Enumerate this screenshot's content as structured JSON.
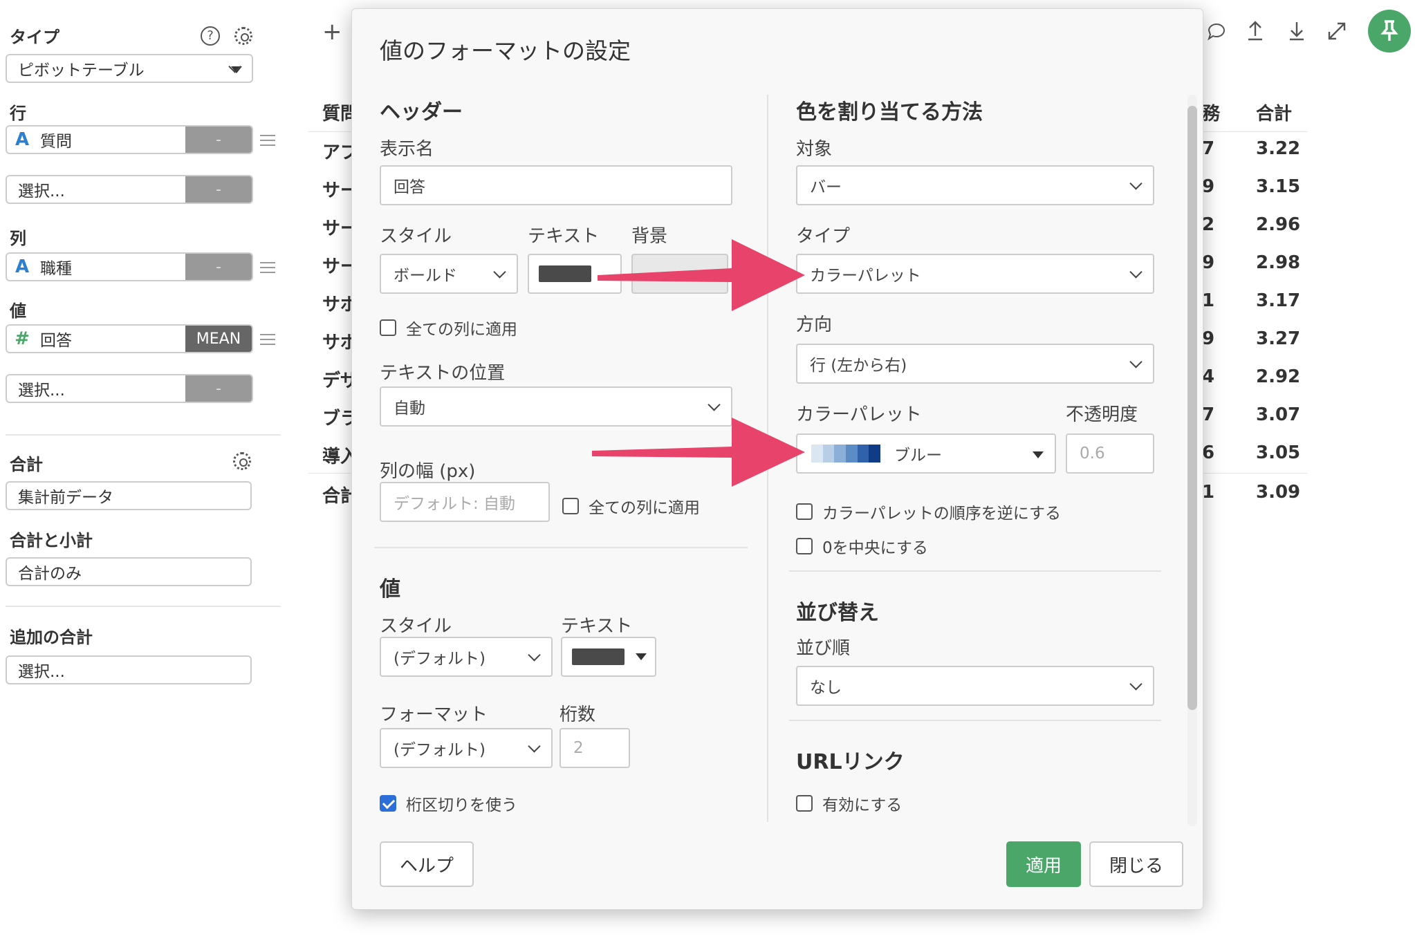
{
  "left": {
    "type_label": "タイプ",
    "type_value": "ピボットテーブル",
    "rows_label": "行",
    "row_field": {
      "type": "A",
      "name": "質問",
      "agg": "-"
    },
    "row_select": {
      "placeholder": "選択...",
      "agg": "-"
    },
    "cols_label": "列",
    "col_field": {
      "type": "A",
      "name": "職種",
      "agg": "-"
    },
    "values_label": "値",
    "value_field": {
      "type": "#",
      "name": "回答",
      "agg": "MEAN"
    },
    "value_select": {
      "placeholder": "選択...",
      "agg": "-"
    },
    "total_label": "合計",
    "total_value": "集計前データ",
    "subtotal_label": "合計と小計",
    "subtotal_value": "合計のみ",
    "extra_total_label": "追加の合計",
    "extra_total_value": "選択..."
  },
  "table": {
    "row_headers": [
      "質問",
      "アプ",
      "サー",
      "サー",
      "サー",
      "サポ",
      "サポ",
      "デザ",
      "ブラ",
      "導入",
      "合計"
    ],
    "partial_col": [
      "務",
      "7",
      "9",
      "2",
      "9",
      "1",
      "9",
      "4",
      "7",
      "6",
      "1"
    ],
    "total_header": "合計",
    "totals": [
      "3.22",
      "3.15",
      "2.96",
      "2.98",
      "3.17",
      "3.27",
      "2.92",
      "3.07",
      "3.05",
      "3.09"
    ]
  },
  "toolbar": {
    "add": "+",
    "icons": [
      "comment-icon",
      "upload-icon",
      "download-icon",
      "expand-icon",
      "pin-icon"
    ]
  },
  "dialog": {
    "title": "値のフォーマットの設定",
    "header_section": "ヘッダー",
    "display_name_label": "表示名",
    "display_name_value": "回答",
    "style_label": "スタイル",
    "text_label": "テキスト",
    "bg_label": "背景",
    "style_value": "ボールド",
    "apply_all_1": "全ての列に適用",
    "text_pos_label": "テキストの位置",
    "text_pos_value": "自動",
    "col_width_label": "列の幅 (px)",
    "col_width_placeholder": "デフォルト: 自動",
    "apply_all_2": "全ての列に適用",
    "value_section": "値",
    "v_style_label": "スタイル",
    "v_text_label": "テキスト",
    "v_style_value": "(デフォルト)",
    "format_label": "フォーマット",
    "digits_label": "桁数",
    "format_value": "(デフォルト)",
    "digits_placeholder": "2",
    "thousands_sep": "桁区切りを使う",
    "color_section": "色を割り当てる方法",
    "target_label": "対象",
    "target_value": "バー",
    "type_label": "タイプ",
    "type_value": "カラーパレット",
    "direction_label": "方向",
    "direction_value": "行 (左から右)",
    "palette_label": "カラーパレット",
    "opacity_label": "不透明度",
    "palette_value": "ブルー",
    "opacity_placeholder": "0.6",
    "reverse_palette": "カラーパレットの順序を逆にする",
    "center_zero": "0を中央にする",
    "sort_section": "並び替え",
    "sort_order_label": "並び順",
    "sort_order_value": "なし",
    "url_section": "URLリンク",
    "url_enable": "有効にする",
    "help_btn": "ヘルプ",
    "apply_btn": "適用",
    "close_btn": "閉じる"
  },
  "colors": {
    "accent_green": "#4aa769",
    "checkbox_blue": "#2d6fd8",
    "arrow_pink": "#e8436a",
    "swatch_dark": "#4a4a4a",
    "palette_gradient": [
      "#dbe6f3",
      "#b8cde6",
      "#8bafd8",
      "#5b8cc6",
      "#2f62aa",
      "#103b86"
    ]
  }
}
